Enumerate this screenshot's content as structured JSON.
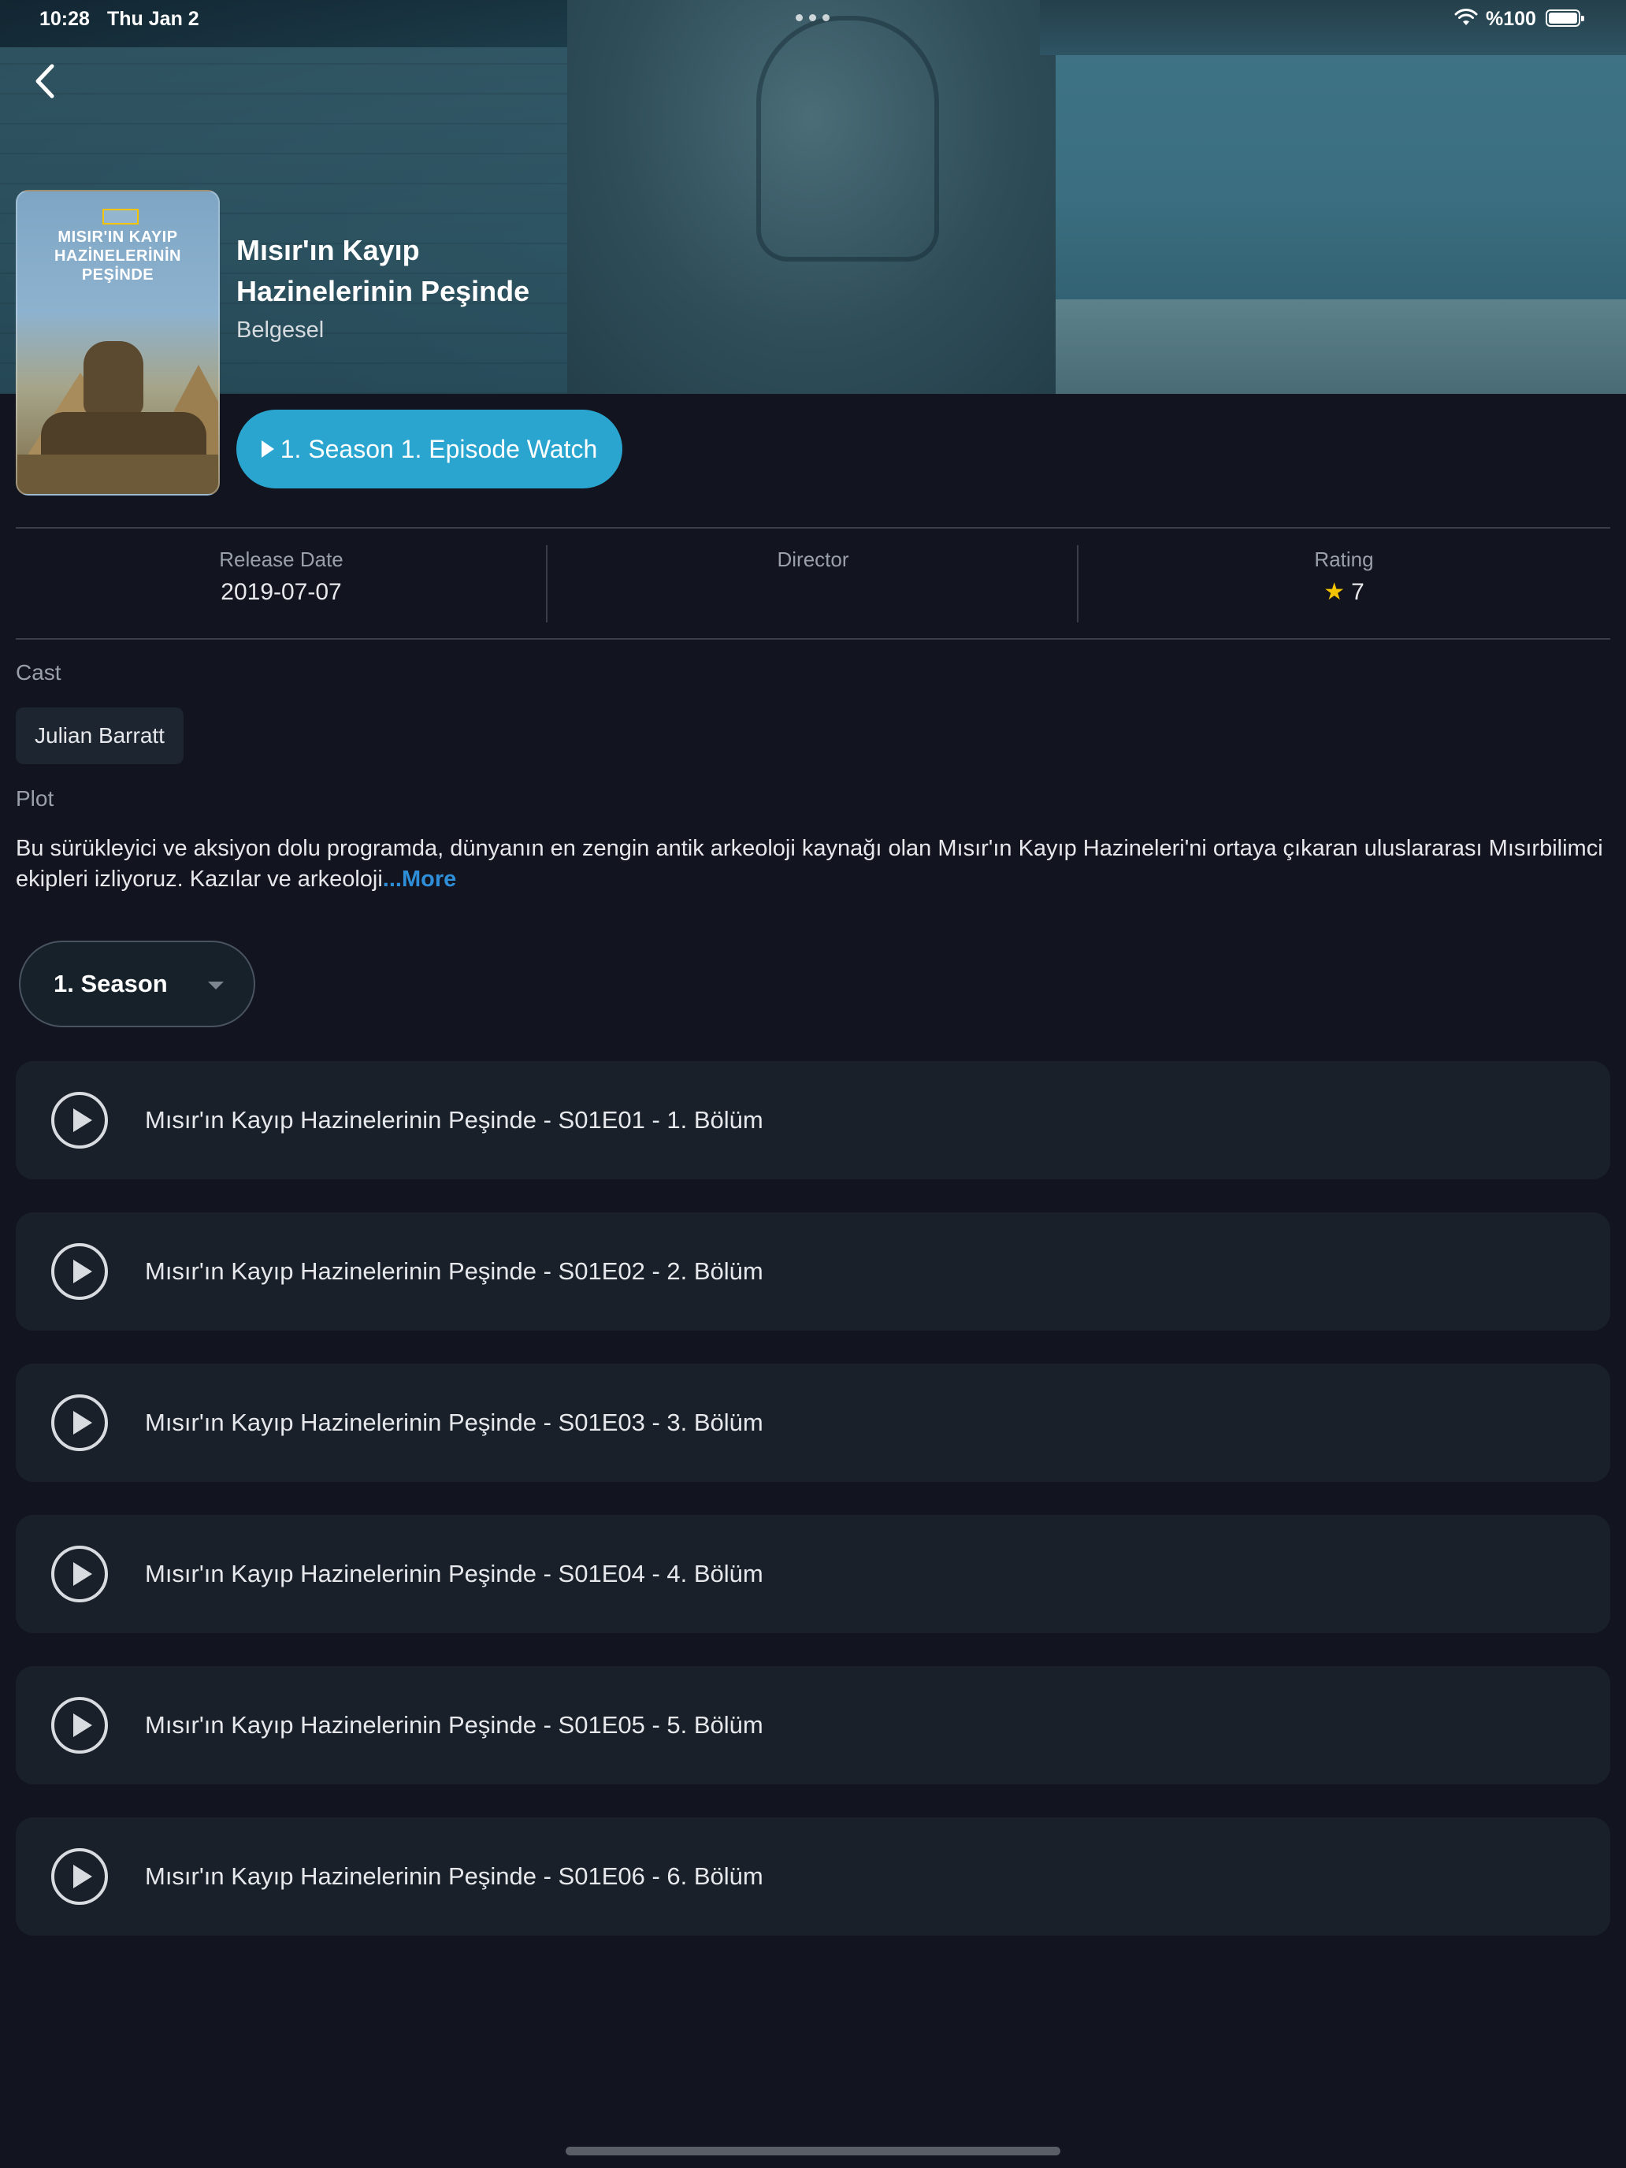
{
  "status_bar": {
    "time": "10:28",
    "date": "Thu Jan 2",
    "battery": "%100"
  },
  "show": {
    "title": "Mısır'ın Kayıp Hazinelerinin Peşinde",
    "genre": "Belgesel",
    "poster_title": "MISIR'IN KAYIP HAZİNELERİNİN PEŞİNDE"
  },
  "watch_button": {
    "label": "1. Season 1. Episode Watch"
  },
  "info": {
    "release_label": "Release Date",
    "release_value": "2019-07-07",
    "director_label": "Director",
    "director_value": "",
    "rating_label": "Rating",
    "rating_value": "7"
  },
  "cast": {
    "label": "Cast",
    "members": [
      "Julian Barratt"
    ]
  },
  "plot": {
    "label": "Plot",
    "text": "Bu sürükleyici ve aksiyon dolu programda, dünyanın en zengin antik arkeoloji kaynağı olan Mısır'ın Kayıp Hazineleri'ni ortaya çıkaran uluslararası Mısırbilimci ekipleri izliyoruz. Kazılar ve arkeoloji",
    "more": "...More"
  },
  "season_select": {
    "selected": "1. Season"
  },
  "episodes": [
    "Mısır'ın Kayıp Hazinelerinin Peşinde - S01E01 - 1. Bölüm",
    "Mısır'ın Kayıp Hazinelerinin Peşinde - S01E02 - 2. Bölüm",
    "Mısır'ın Kayıp Hazinelerinin Peşinde - S01E03 - 3. Bölüm",
    "Mısır'ın Kayıp Hazinelerinin Peşinde - S01E04 - 4. Bölüm",
    "Mısır'ın Kayıp Hazinelerinin Peşinde - S01E05 - 5. Bölüm",
    "Mısır'ın Kayıp Hazinelerinin Peşinde - S01E06 - 6. Bölüm"
  ],
  "colors": {
    "background": "#12141f",
    "accent": "#2aa5cf",
    "link": "#2e8fd8",
    "star": "#f5c400"
  }
}
